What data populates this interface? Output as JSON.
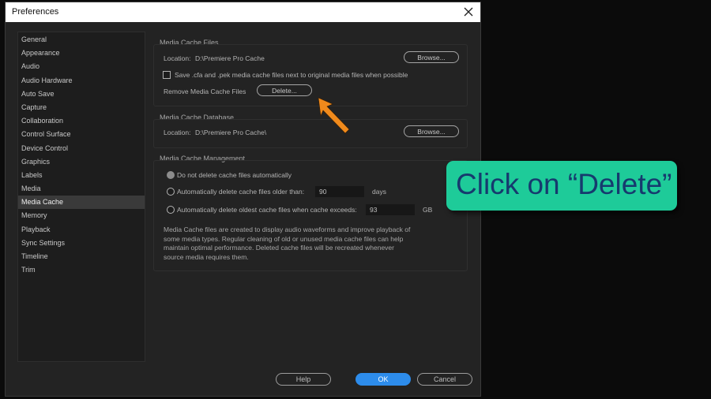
{
  "window": {
    "title": "Preferences",
    "close_icon": "close-icon"
  },
  "sidebar": {
    "items": [
      {
        "label": "General"
      },
      {
        "label": "Appearance"
      },
      {
        "label": "Audio"
      },
      {
        "label": "Audio Hardware"
      },
      {
        "label": "Auto Save"
      },
      {
        "label": "Capture"
      },
      {
        "label": "Collaboration"
      },
      {
        "label": "Control Surface"
      },
      {
        "label": "Device Control"
      },
      {
        "label": "Graphics"
      },
      {
        "label": "Labels"
      },
      {
        "label": "Media"
      },
      {
        "label": "Media Cache"
      },
      {
        "label": "Memory"
      },
      {
        "label": "Playback"
      },
      {
        "label": "Sync Settings"
      },
      {
        "label": "Timeline"
      },
      {
        "label": "Trim"
      }
    ],
    "active_item": "Media Cache"
  },
  "media_cache_files": {
    "title": "Media Cache Files",
    "location_label": "Location:",
    "location_value": "D:\\Premiere Pro Cache",
    "browse_label": "Browse...",
    "save_checkbox_label": "Save .cfa and .pek media cache files next to original media files when possible",
    "save_checked": false,
    "remove_label": "Remove Media Cache Files",
    "delete_label": "Delete..."
  },
  "media_cache_database": {
    "title": "Media Cache Database",
    "location_label": "Location:",
    "location_value": "D:\\Premiere Pro Cache\\",
    "browse_label": "Browse..."
  },
  "media_cache_management": {
    "title": "Media Cache Management",
    "option_no_delete": "Do not delete cache files automatically",
    "option_older_than": "Automatically delete cache files older than:",
    "older_than_value": "90",
    "older_than_unit": "days",
    "option_exceeds": "Automatically delete oldest cache files when cache exceeds:",
    "exceeds_value": "93",
    "exceeds_unit": "GB",
    "description_lines": [
      "Media Cache files are created to display audio waveforms and improve playback of",
      "some media types.  Regular cleaning of old or unused media cache files can help",
      "maintain optimal performance. Deleted cache files will be recreated whenever",
      "source media requires them."
    ]
  },
  "footer": {
    "help_label": "Help",
    "ok_label": "OK",
    "cancel_label": "Cancel"
  },
  "annotation": {
    "callout_text": "Click on “Delete”",
    "callout_color": "#1ecb99",
    "callout_text_color": "#163a6e",
    "arrow_color": "#f08a1c"
  }
}
